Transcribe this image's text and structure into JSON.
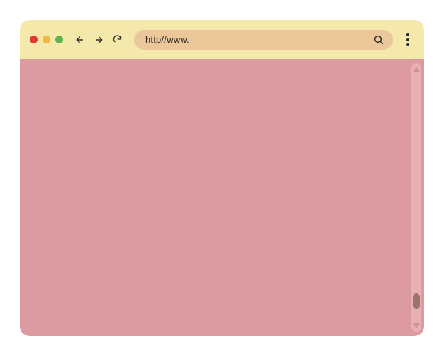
{
  "window": {
    "controls": {
      "close_color": "#e23a32",
      "minimize_color": "#f3b83e",
      "maximize_color": "#5bb450"
    }
  },
  "address_bar": {
    "url_text": "http//www."
  },
  "colors": {
    "titlebar_bg": "#f4e9ab",
    "address_bg": "#ebc79a",
    "content_bg": "#dc9ba1",
    "scrollbar_bg": "#e8b0b5",
    "scroll_thumb": "#9a7466"
  }
}
